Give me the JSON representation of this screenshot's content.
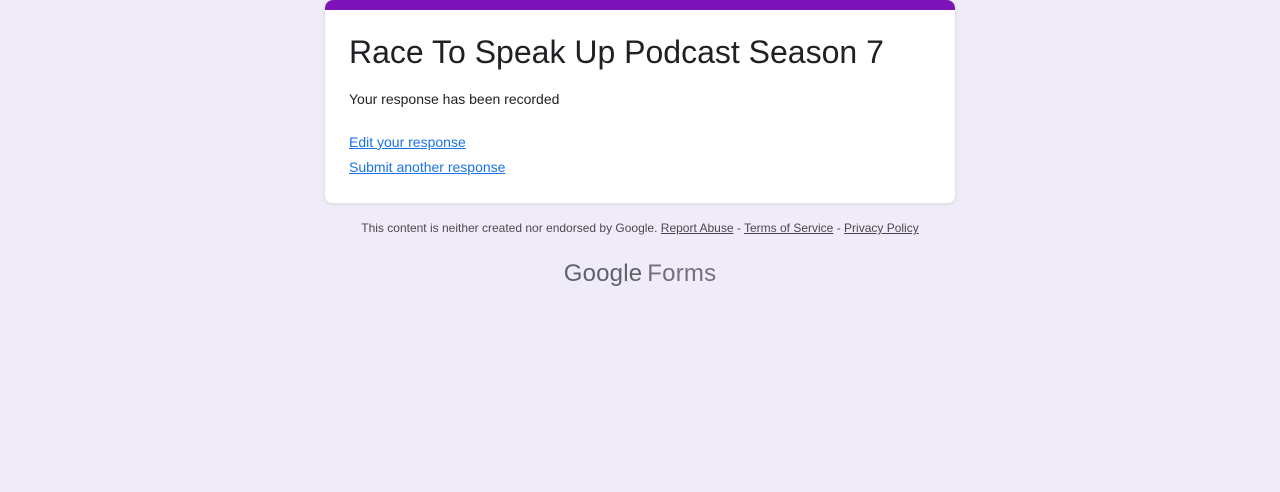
{
  "theme": {
    "page_background": "#f0ebf8",
    "accent_bar_color": "#7c12b8",
    "card_background": "#ffffff",
    "action_link_color": "#1a73e8"
  },
  "card": {
    "title": "Race To Speak Up Podcast Season 7",
    "confirmation": "Your response has been recorded",
    "links": [
      {
        "label": "Edit your response"
      },
      {
        "label": "Submit another response"
      }
    ]
  },
  "footer": {
    "disclaimer": "This content is neither created nor endorsed by Google.",
    "separator": "-",
    "links": [
      {
        "label": "Report Abuse"
      },
      {
        "label": "Terms of Service"
      },
      {
        "label": "Privacy Policy"
      }
    ],
    "logo": {
      "brand": "Google",
      "product": "Forms"
    }
  }
}
